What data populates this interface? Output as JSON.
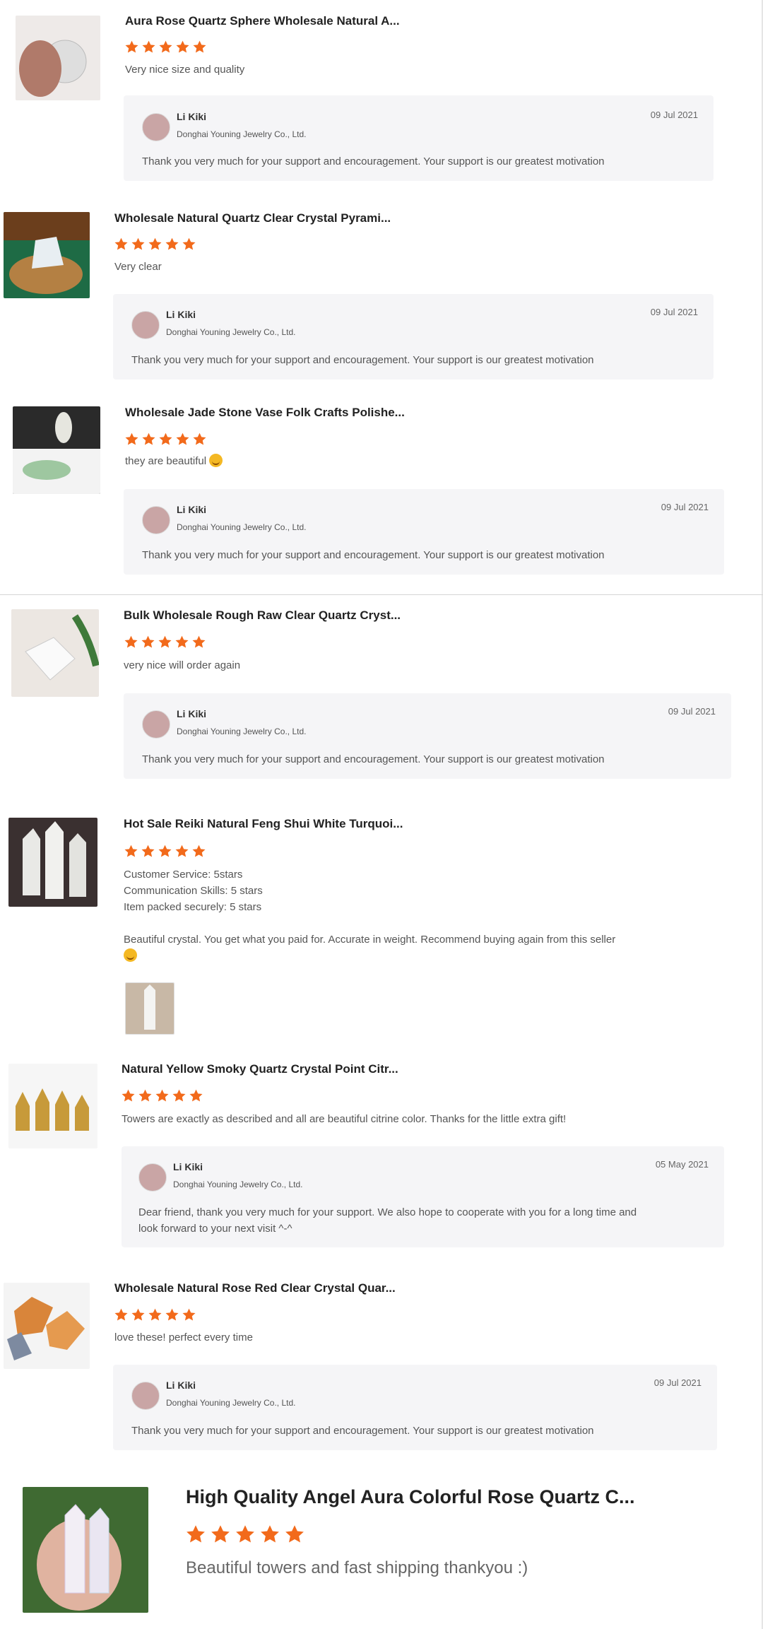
{
  "colors": {
    "star": "#f26a1b",
    "reply_bg": "#f5f5f7"
  },
  "reviews": [
    {
      "product": "Aura Rose Quartz Sphere Wholesale Natural A...",
      "rating": 5,
      "comment": "Very nice size and quality",
      "reply": {
        "name": "Li Kiki",
        "company": "Donghai Youning Jewelry Co., Ltd.",
        "date": "09 Jul 2021",
        "text": "Thank you very much for your support and encouragement. Your support is our greatest motivation"
      }
    },
    {
      "product": "Wholesale Natural Quartz Clear Crystal Pyrami...",
      "rating": 5,
      "comment": "Very clear",
      "reply": {
        "name": "Li Kiki",
        "company": "Donghai Youning Jewelry Co., Ltd.",
        "date": "09 Jul 2021",
        "text": "Thank you very much for your support and encouragement. Your support is our greatest motivation"
      }
    },
    {
      "product": "Wholesale Jade Stone Vase Folk Crafts Polishe...",
      "rating": 5,
      "comment": "they are beautiful",
      "reply": {
        "name": "Li Kiki",
        "company": "Donghai Youning Jewelry Co., Ltd.",
        "date": "09 Jul 2021",
        "text": "Thank you very much for your support and encouragement. Your support is our greatest motivation"
      }
    },
    {
      "product": "Bulk Wholesale Rough Raw Clear Quartz Cryst...",
      "rating": 5,
      "comment": "very nice will order again",
      "reply": {
        "name": "Li Kiki",
        "company": "Donghai Youning Jewelry Co., Ltd.",
        "date": "09 Jul 2021",
        "text": "Thank you very much for your support and encouragement. Your support is our greatest motivation"
      }
    },
    {
      "product": "Hot Sale Reiki Natural Feng Shui White Turquoi...",
      "rating": 5,
      "comment_lines": [
        "Customer Service: 5stars",
        "Communication Skills: 5 stars",
        "Item packed securely: 5 stars"
      ],
      "comment2": "Beautiful crystal. You get what you paid for. Accurate in weight. Recommend buying again from this seller"
    },
    {
      "product": "Natural Yellow Smoky Quartz Crystal Point Citr...",
      "rating": 5,
      "comment": "Towers are exactly as described and all are beautiful citrine color.  Thanks for the little extra gift!",
      "reply": {
        "name": "Li Kiki",
        "company": "Donghai Youning Jewelry Co., Ltd.",
        "date": "05 May 2021",
        "text_line1": "Dear friend, thank you very much for your support. We also hope to cooperate with you for a long time and",
        "text_line2": "look forward to your next visit ^-^"
      }
    },
    {
      "product": "Wholesale Natural Rose Red Clear Crystal Quar...",
      "rating": 5,
      "comment": "love these! perfect every time",
      "reply": {
        "name": "Li Kiki",
        "company": "Donghai Youning Jewelry Co., Ltd.",
        "date": "09 Jul 2021",
        "text": "Thank you very much for your support and encouragement. Your support is our greatest motivation"
      }
    },
    {
      "product": "High Quality Angel Aura Colorful Rose Quartz C...",
      "rating": 5,
      "comment": "Beautiful towers and fast shipping thankyou :)"
    }
  ]
}
